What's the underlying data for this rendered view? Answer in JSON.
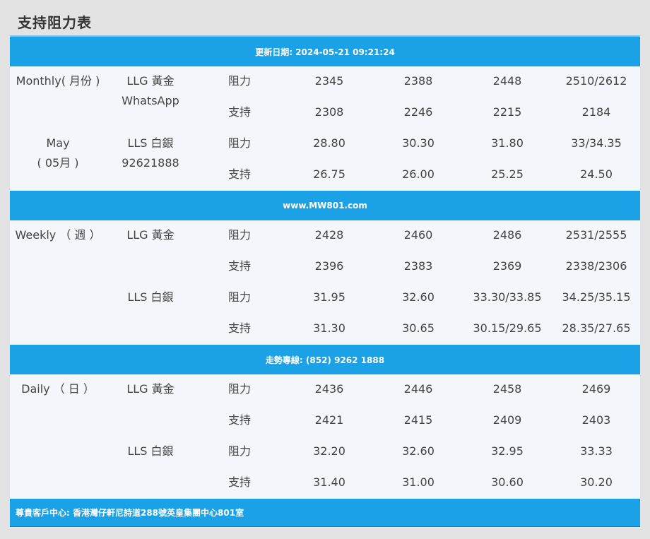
{
  "page_title": "支持阻力表",
  "update_banner": "更新日期: 2024-05-21 09:21:24",
  "website_banner": "www.MW801.com",
  "hotline_banner": "走勢專線: (852) 9262 1888",
  "footer_banner": "尊貴客戶中心: 香港灣仔軒尼詩道288號英皇集團中心801室",
  "colors": {
    "accent": "#1ba1e5",
    "panel": "#f3f6fa",
    "page": "#e3e3e3"
  },
  "monthly": {
    "period_label": "Monthly( 月份 )",
    "month_label": "May",
    "month_sub": "( 05月 )",
    "contact_label": "WhatsApp",
    "contact_number": "92621888",
    "rows": [
      {
        "product": "LLG 黃金",
        "type": "阻力",
        "values": [
          "2345",
          "2388",
          "2448",
          "2510/2612"
        ]
      },
      {
        "product": "",
        "type": "支持",
        "values": [
          "2308",
          "2246",
          "2215",
          "2184"
        ]
      },
      {
        "product": "LLS 白銀",
        "type": "阻力",
        "values": [
          "28.80",
          "30.30",
          "31.80",
          "33/34.35"
        ]
      },
      {
        "product": "",
        "type": "支持",
        "values": [
          "26.75",
          "26.00",
          "25.25",
          "24.50"
        ]
      }
    ]
  },
  "weekly": {
    "period_label": "Weekly （ 週 ）",
    "rows": [
      {
        "product": "LLG 黃金",
        "type": "阻力",
        "values": [
          "2428",
          "2460",
          "2486",
          "2531/2555"
        ]
      },
      {
        "product": "",
        "type": "支持",
        "values": [
          "2396",
          "2383",
          "2369",
          "2338/2306"
        ]
      },
      {
        "product": "LLS 白銀",
        "type": "阻力",
        "values": [
          "31.95",
          "32.60",
          "33.30/33.85",
          "34.25/35.15"
        ]
      },
      {
        "product": "",
        "type": "支持",
        "values": [
          "31.30",
          "30.65",
          "30.15/29.65",
          "28.35/27.65"
        ]
      }
    ]
  },
  "daily": {
    "period_label": "Daily （ 日 ）",
    "rows": [
      {
        "product": "LLG 黃金",
        "type": "阻力",
        "values": [
          "2436",
          "2446",
          "2458",
          "2469"
        ]
      },
      {
        "product": "",
        "type": "支持",
        "values": [
          "2421",
          "2415",
          "2409",
          "2403"
        ]
      },
      {
        "product": "LLS 白銀",
        "type": "阻力",
        "values": [
          "32.20",
          "32.60",
          "32.95",
          "33.33"
        ]
      },
      {
        "product": "",
        "type": "支持",
        "values": [
          "31.40",
          "31.00",
          "30.60",
          "30.20"
        ]
      }
    ]
  }
}
